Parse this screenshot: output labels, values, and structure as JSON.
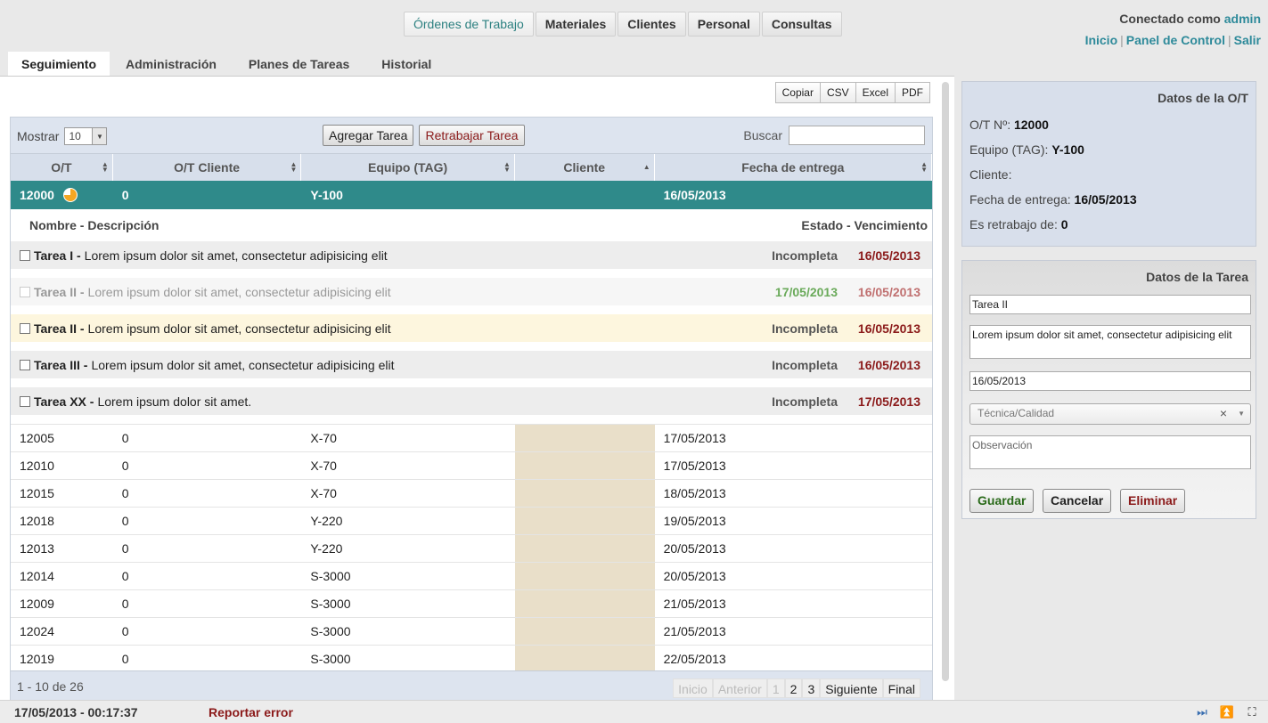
{
  "nav": {
    "items": [
      "Órdenes de Trabajo",
      "Materiales",
      "Clientes",
      "Personal",
      "Consultas"
    ]
  },
  "user": {
    "connected_as": "Conectado como",
    "username": "admin",
    "links": [
      "Inicio",
      "Panel de Control",
      "Salir"
    ]
  },
  "subtabs": [
    "Seguimiento",
    "Administración",
    "Planes de Tareas",
    "Historial"
  ],
  "export": [
    "Copiar",
    "CSV",
    "Excel",
    "PDF"
  ],
  "grid": {
    "show_label": "Mostrar",
    "page_size": "10",
    "add_task": "Agregar Tarea",
    "rework_task": "Retrabajar Tarea",
    "search_label": "Buscar",
    "search_value": "",
    "columns": [
      "O/T",
      "O/T Cliente",
      "Equipo (TAG)",
      "Cliente",
      "Fecha de entrega"
    ],
    "selected": {
      "ot": "12000",
      "ot_cliente": "0",
      "equipo": "Y-100",
      "cliente": "",
      "fecha": "16/05/2013",
      "progress": 0.75
    },
    "task_header": {
      "left": "Nombre - Descripción",
      "right": "Estado - Vencimiento"
    },
    "tasks": [
      {
        "name": "Tarea I -",
        "desc": "Lorem ipsum dolor sit amet, consectetur adipisicing elit",
        "state": "Incompleta",
        "due": "16/05/2013",
        "style": "gray"
      },
      {
        "name": "Tarea II -",
        "desc": "Lorem ipsum dolor sit amet, consectetur adipisicing elit",
        "state": "17/05/2013",
        "due": "16/05/2013",
        "style": "faded"
      },
      {
        "name": "Tarea II -",
        "desc": "Lorem ipsum dolor sit amet, consectetur adipisicing elit",
        "state": "Incompleta",
        "due": "16/05/2013",
        "style": "yellow"
      },
      {
        "name": "Tarea III -",
        "desc": "Lorem ipsum dolor sit amet, consectetur adipisicing elit",
        "state": "Incompleta",
        "due": "16/05/2013",
        "style": "gray"
      },
      {
        "name": "Tarea XX -",
        "desc": "Lorem ipsum dolor sit amet.",
        "state": "Incompleta",
        "due": "17/05/2013",
        "style": "gray"
      }
    ],
    "rows": [
      {
        "ot": "12005",
        "ot_cliente": "0",
        "equipo": "X-70",
        "cliente": "",
        "fecha": "17/05/2013"
      },
      {
        "ot": "12010",
        "ot_cliente": "0",
        "equipo": "X-70",
        "cliente": "",
        "fecha": "17/05/2013"
      },
      {
        "ot": "12015",
        "ot_cliente": "0",
        "equipo": "X-70",
        "cliente": "",
        "fecha": "18/05/2013"
      },
      {
        "ot": "12018",
        "ot_cliente": "0",
        "equipo": "Y-220",
        "cliente": "",
        "fecha": "19/05/2013"
      },
      {
        "ot": "12013",
        "ot_cliente": "0",
        "equipo": "Y-220",
        "cliente": "",
        "fecha": "20/05/2013"
      },
      {
        "ot": "12014",
        "ot_cliente": "0",
        "equipo": "S-3000",
        "cliente": "",
        "fecha": "20/05/2013"
      },
      {
        "ot": "12009",
        "ot_cliente": "0",
        "equipo": "S-3000",
        "cliente": "",
        "fecha": "21/05/2013"
      },
      {
        "ot": "12024",
        "ot_cliente": "0",
        "equipo": "S-3000",
        "cliente": "",
        "fecha": "21/05/2013"
      },
      {
        "ot": "12019",
        "ot_cliente": "0",
        "equipo": "S-3000",
        "cliente": "",
        "fecha": "22/05/2013"
      }
    ],
    "info": "1 - 10 de 26",
    "pager": {
      "first": "Inicio",
      "prev": "Anterior",
      "pages": [
        "1",
        "2",
        "3"
      ],
      "next": "Siguiente",
      "last": "Final"
    }
  },
  "ot_panel": {
    "title": "Datos de la O/T",
    "ot_label": "O/T Nº:",
    "ot_value": "12000",
    "equipo_label": "Equipo (TAG):",
    "equipo_value": "Y-100",
    "cliente_label": "Cliente:",
    "cliente_value": "",
    "fecha_label": "Fecha de entrega:",
    "fecha_value": "16/05/2013",
    "retrabajo_label": "Es retrabajo de:",
    "retrabajo_value": "0"
  },
  "task_panel": {
    "title": "Datos de la Tarea",
    "name": "Tarea II",
    "desc": "Lorem ipsum dolor sit amet, consectetur adipisicing elit",
    "date": "16/05/2013",
    "category": "Técnica/Calidad",
    "observation_placeholder": "Observación",
    "save": "Guardar",
    "cancel": "Cancelar",
    "delete": "Eliminar"
  },
  "status": {
    "datetime": "17/05/2013 - 00:17:37",
    "report": "Reportar error",
    "icons": [
      "play-end-icon",
      "collapse-up-icon",
      "fullscreen-icon"
    ]
  }
}
